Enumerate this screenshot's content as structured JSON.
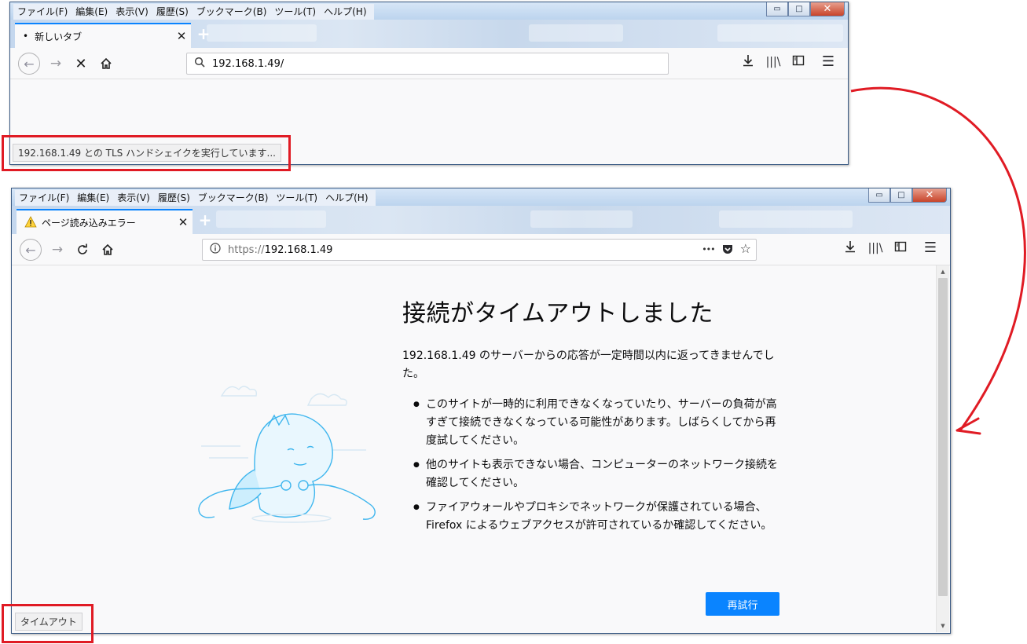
{
  "menu": [
    "ファイル(F)",
    "編集(E)",
    "表示(V)",
    "履歴(S)",
    "ブックマーク(B)",
    "ツール(T)",
    "ヘルプ(H)"
  ],
  "window_controls": {
    "minimize": "▭",
    "maximize": "□",
    "close": "✕"
  },
  "window1": {
    "tab_label": "新しいタブ",
    "tab_bullet": "•",
    "url": "192.168.1.49/",
    "status_text": "192.168.1.49 との TLS ハンドシェイクを実行しています..."
  },
  "window2": {
    "tab_label": "ページ読み込みエラー",
    "url_scheme": "https://",
    "url_host": "192.168.1.49",
    "page_actions_label": "•••",
    "error_title": "接続がタイムアウトしました",
    "error_description": "192.168.1.49 のサーバーからの応答が一定時間以内に返ってきませんでした。",
    "suggestions": [
      "このサイトが一時的に利用できなくなっていたり、サーバーの負荷が高すぎて接続できなくなっている可能性があります。しばらくしてから再度試してください。",
      "他のサイトも表示できない場合、コンピューターのネットワーク接続を確認してください。",
      "ファイアウォールやプロキシでネットワークが保護されている場合、Firefox によるウェブアクセスが許可されているか確認してください。"
    ],
    "retry_label": "再試行",
    "status_text": "タイムアウト"
  },
  "icons": {
    "back": "back-arrow-icon",
    "forward": "forward-arrow-icon",
    "stop": "stop-icon",
    "reload": "reload-icon",
    "home": "home-icon",
    "search": "search-icon",
    "info": "info-icon",
    "pocket": "pocket-icon",
    "bookmark_star": "star-icon",
    "downloads": "download-icon",
    "library": "library-icon",
    "sidebar": "sidebar-icon",
    "menu": "hamburger-menu-icon",
    "warning": "warning-icon"
  },
  "colors": {
    "accent_blue": "#0a84ff",
    "annotation_red": "#e01b24",
    "illustration_blue": "#3fb6ee"
  }
}
